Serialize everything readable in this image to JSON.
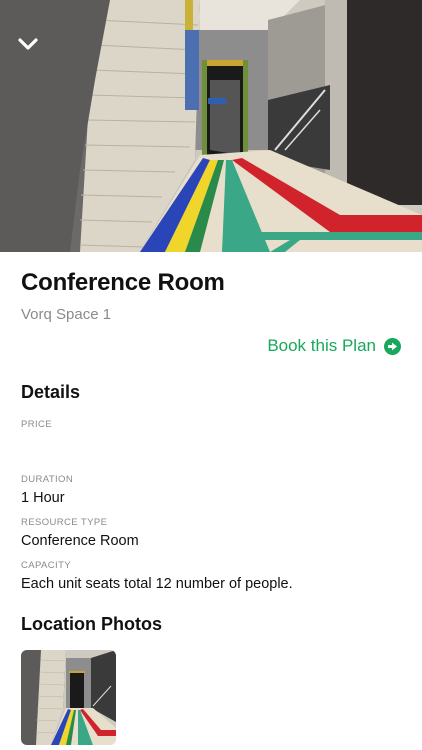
{
  "hero": {
    "image_icon": "corridor-photo",
    "back_icon": "chevron-down-icon"
  },
  "space": {
    "title": "Conference Room",
    "subtitle": "Vorq Space 1"
  },
  "actions": {
    "book_label": "Book this Plan",
    "book_icon": "arrow-right-circle-icon",
    "accent_color": "#18a85a"
  },
  "details": {
    "heading": "Details",
    "price_label": "PRICE",
    "price_value": "",
    "duration_label": "DURATION",
    "duration_value": "1 Hour",
    "resource_type_label": "RESOURCE TYPE",
    "resource_type_value": "Conference Room",
    "capacity_label": "CAPACITY",
    "capacity_value": "Each unit seats total 12 number of people."
  },
  "location": {
    "heading": "Location Photos",
    "photos": [
      "corridor-photo-thumbnail"
    ]
  }
}
